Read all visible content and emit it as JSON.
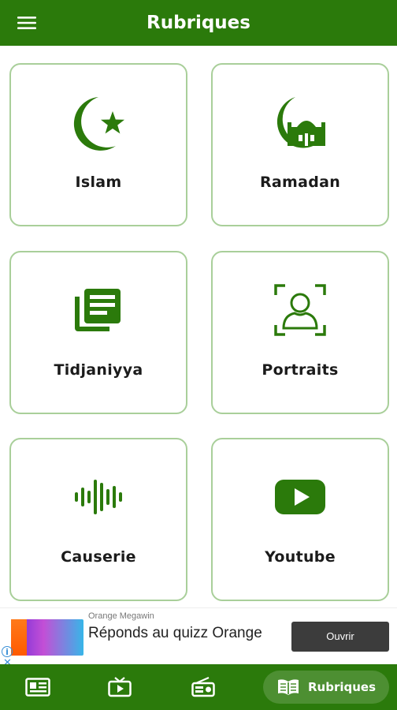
{
  "app_bar": {
    "title": "Rubriques",
    "menu_icon": "hamburger-menu-icon"
  },
  "categories": [
    {
      "label": "Islam",
      "icon": "crescent-star-icon"
    },
    {
      "label": "Ramadan",
      "icon": "crescent-mosque-icon"
    },
    {
      "label": "Tidjaniyya",
      "icon": "document-stack-icon"
    },
    {
      "label": "Portraits",
      "icon": "portrait-frame-icon"
    },
    {
      "label": "Causerie",
      "icon": "audio-waveform-icon"
    },
    {
      "label": "Youtube",
      "icon": "youtube-play-icon"
    }
  ],
  "ad": {
    "advertiser": "Orange Megawin",
    "headline": "Réponds au quizz Orange",
    "cta": "Ouvrir"
  },
  "bottom_nav": {
    "items": [
      {
        "icon": "newspaper-icon",
        "label": ""
      },
      {
        "icon": "tv-icon",
        "label": ""
      },
      {
        "icon": "radio-icon",
        "label": ""
      },
      {
        "icon": "book-icon",
        "label": "Rubriques",
        "active": true
      }
    ]
  },
  "colors": {
    "primary": "#2b7a0b",
    "card_border": "#a9cf9a",
    "icon": "#2b7a0b"
  }
}
